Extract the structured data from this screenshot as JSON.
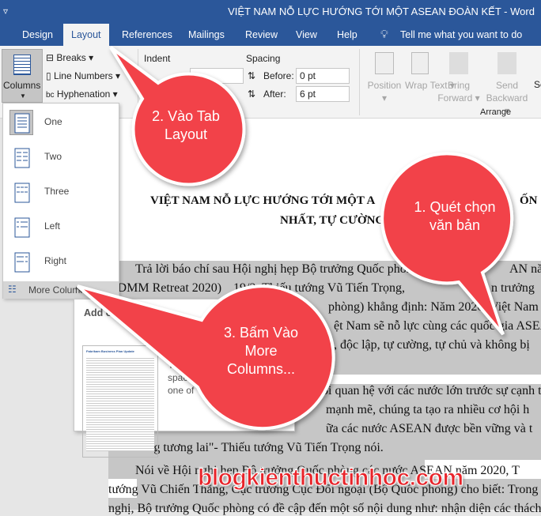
{
  "window": {
    "title": "VIỆT NAM NỖ LỰC HƯỚNG TỚI MỘT ASEAN ĐOÀN KẾT  -  Word",
    "qat_icon": "customize-qat-icon"
  },
  "tabs": [
    {
      "label": "Design"
    },
    {
      "label": "Layout",
      "active": true
    },
    {
      "label": "References"
    },
    {
      "label": "Mailings"
    },
    {
      "label": "Review"
    },
    {
      "label": "View"
    },
    {
      "label": "Help"
    }
  ],
  "tell_me": "Tell me what you want to do",
  "ribbon": {
    "columns": "Columns",
    "breaks": "Breaks",
    "line_numbers": "Line Numbers",
    "hyphenation": "Hyphenation",
    "indent": "Indent",
    "spacing": "Spacing",
    "before_label": "Before:",
    "before_value": "0 pt",
    "after_label": "After:",
    "after_value": "6 pt",
    "position": "Position",
    "wrap_text": "Wrap Text",
    "bring_forward": "Bring Forward",
    "send_backward": "Send Backward",
    "select_partial": "Se",
    "arrange": "Arrange"
  },
  "columns_menu": {
    "items": [
      {
        "label": "One"
      },
      {
        "label": "Two"
      },
      {
        "label": "Three"
      },
      {
        "label": "Left"
      },
      {
        "label": "Right"
      }
    ],
    "more": "More Columns..."
  },
  "tooltip": {
    "title": "Add or Rem",
    "preview_title": "Fabrikam Business Plan Update",
    "line1": "co",
    "line2": "You",
    "line3": "spaci",
    "line4": "one of"
  },
  "document": {
    "title1": "VIỆT NAM NỖ LỰC HƯỚNG TỚI MỘT A",
    "title1_end": "ỐN",
    "title2": "NHẤT, TỰ CƯỜNG",
    "lines": [
      "Trả lời báo chí sau Hội nghị hẹp Bộ trưởng Quốc phòng",
      "ADMM Retreat 2020)",
      "phòng) khẳng định: Năm 2020, Việt Nam",
      "ệt Nam sẽ nỗ lực cùng các quốc gia ASEAN",
      ", độc lập, tự cường, tự chủ và không bị",
      "ối quan hệ với các nước lớn trước sự cạnh t",
      "mạnh mẽ, chúng ta tạo ra nhiều cơ hội h",
      "ữa các nước ASEAN được bền vững và t",
      "nhất trong tương lai\"- Thiếu tướng Vũ Tiến Trọng nói.",
      "Nói về Hội nghị hẹp Bộ trưởng Quốc phòng các nước ASEAN năm 2020, T",
      "tướng Vũ Chiến Thắng, Cục trưởng Cục Đối ngoại (Bộ Quốc phòng) cho biết: Trong",
      "nghị, Bộ trưởng Quốc phòng có đề cập đến một số nội dung như: nhận diện các thách"
    ],
    "line1_end": "AN năm",
    "line2_mid": "19/2, Thiếu tướng Vũ Tiến Trọng,",
    "line2_end": "n trưởng"
  },
  "callouts": [
    {
      "text": "1. Quét chọn văn bản"
    },
    {
      "text": "2. Vào Tab Layout"
    },
    {
      "text": "3. Bấm Vào More Columns..."
    }
  ],
  "watermark": "blogkienthuctinhoc.com",
  "colors": {
    "brand": "#2b579a",
    "callout": "#f2434a",
    "selection": "#c6c6c6"
  }
}
